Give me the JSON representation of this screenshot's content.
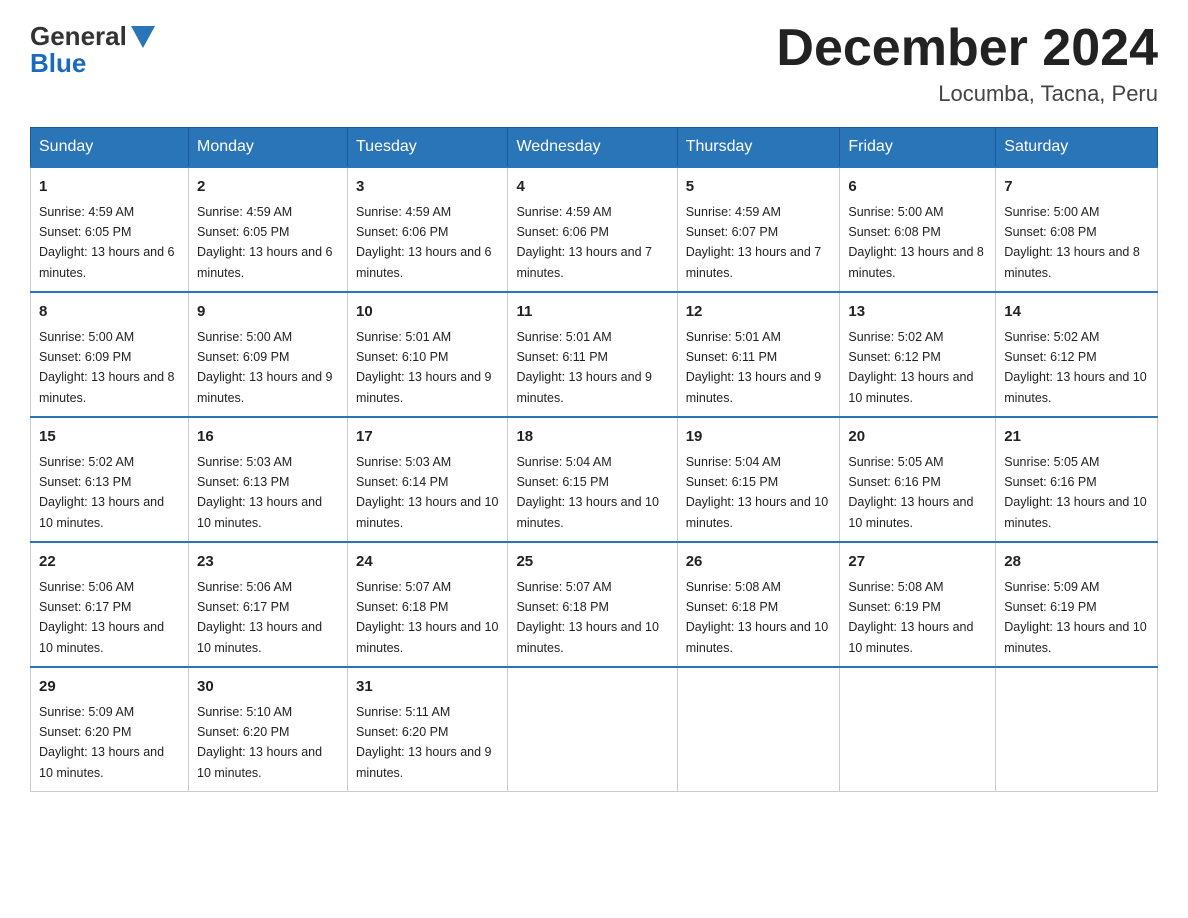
{
  "header": {
    "logo_general": "General",
    "logo_blue": "Blue",
    "main_title": "December 2024",
    "subtitle": "Locumba, Tacna, Peru"
  },
  "days_of_week": [
    "Sunday",
    "Monday",
    "Tuesday",
    "Wednesday",
    "Thursday",
    "Friday",
    "Saturday"
  ],
  "weeks": [
    [
      {
        "num": "1",
        "sunrise": "4:59 AM",
        "sunset": "6:05 PM",
        "daylight": "13 hours and 6 minutes."
      },
      {
        "num": "2",
        "sunrise": "4:59 AM",
        "sunset": "6:05 PM",
        "daylight": "13 hours and 6 minutes."
      },
      {
        "num": "3",
        "sunrise": "4:59 AM",
        "sunset": "6:06 PM",
        "daylight": "13 hours and 6 minutes."
      },
      {
        "num": "4",
        "sunrise": "4:59 AM",
        "sunset": "6:06 PM",
        "daylight": "13 hours and 7 minutes."
      },
      {
        "num": "5",
        "sunrise": "4:59 AM",
        "sunset": "6:07 PM",
        "daylight": "13 hours and 7 minutes."
      },
      {
        "num": "6",
        "sunrise": "5:00 AM",
        "sunset": "6:08 PM",
        "daylight": "13 hours and 8 minutes."
      },
      {
        "num": "7",
        "sunrise": "5:00 AM",
        "sunset": "6:08 PM",
        "daylight": "13 hours and 8 minutes."
      }
    ],
    [
      {
        "num": "8",
        "sunrise": "5:00 AM",
        "sunset": "6:09 PM",
        "daylight": "13 hours and 8 minutes."
      },
      {
        "num": "9",
        "sunrise": "5:00 AM",
        "sunset": "6:09 PM",
        "daylight": "13 hours and 9 minutes."
      },
      {
        "num": "10",
        "sunrise": "5:01 AM",
        "sunset": "6:10 PM",
        "daylight": "13 hours and 9 minutes."
      },
      {
        "num": "11",
        "sunrise": "5:01 AM",
        "sunset": "6:11 PM",
        "daylight": "13 hours and 9 minutes."
      },
      {
        "num": "12",
        "sunrise": "5:01 AM",
        "sunset": "6:11 PM",
        "daylight": "13 hours and 9 minutes."
      },
      {
        "num": "13",
        "sunrise": "5:02 AM",
        "sunset": "6:12 PM",
        "daylight": "13 hours and 10 minutes."
      },
      {
        "num": "14",
        "sunrise": "5:02 AM",
        "sunset": "6:12 PM",
        "daylight": "13 hours and 10 minutes."
      }
    ],
    [
      {
        "num": "15",
        "sunrise": "5:02 AM",
        "sunset": "6:13 PM",
        "daylight": "13 hours and 10 minutes."
      },
      {
        "num": "16",
        "sunrise": "5:03 AM",
        "sunset": "6:13 PM",
        "daylight": "13 hours and 10 minutes."
      },
      {
        "num": "17",
        "sunrise": "5:03 AM",
        "sunset": "6:14 PM",
        "daylight": "13 hours and 10 minutes."
      },
      {
        "num": "18",
        "sunrise": "5:04 AM",
        "sunset": "6:15 PM",
        "daylight": "13 hours and 10 minutes."
      },
      {
        "num": "19",
        "sunrise": "5:04 AM",
        "sunset": "6:15 PM",
        "daylight": "13 hours and 10 minutes."
      },
      {
        "num": "20",
        "sunrise": "5:05 AM",
        "sunset": "6:16 PM",
        "daylight": "13 hours and 10 minutes."
      },
      {
        "num": "21",
        "sunrise": "5:05 AM",
        "sunset": "6:16 PM",
        "daylight": "13 hours and 10 minutes."
      }
    ],
    [
      {
        "num": "22",
        "sunrise": "5:06 AM",
        "sunset": "6:17 PM",
        "daylight": "13 hours and 10 minutes."
      },
      {
        "num": "23",
        "sunrise": "5:06 AM",
        "sunset": "6:17 PM",
        "daylight": "13 hours and 10 minutes."
      },
      {
        "num": "24",
        "sunrise": "5:07 AM",
        "sunset": "6:18 PM",
        "daylight": "13 hours and 10 minutes."
      },
      {
        "num": "25",
        "sunrise": "5:07 AM",
        "sunset": "6:18 PM",
        "daylight": "13 hours and 10 minutes."
      },
      {
        "num": "26",
        "sunrise": "5:08 AM",
        "sunset": "6:18 PM",
        "daylight": "13 hours and 10 minutes."
      },
      {
        "num": "27",
        "sunrise": "5:08 AM",
        "sunset": "6:19 PM",
        "daylight": "13 hours and 10 minutes."
      },
      {
        "num": "28",
        "sunrise": "5:09 AM",
        "sunset": "6:19 PM",
        "daylight": "13 hours and 10 minutes."
      }
    ],
    [
      {
        "num": "29",
        "sunrise": "5:09 AM",
        "sunset": "6:20 PM",
        "daylight": "13 hours and 10 minutes."
      },
      {
        "num": "30",
        "sunrise": "5:10 AM",
        "sunset": "6:20 PM",
        "daylight": "13 hours and 10 minutes."
      },
      {
        "num": "31",
        "sunrise": "5:11 AM",
        "sunset": "6:20 PM",
        "daylight": "13 hours and 9 minutes."
      },
      null,
      null,
      null,
      null
    ]
  ],
  "colors": {
    "header_bg": "#2a74b8",
    "border": "#2a74b8"
  }
}
